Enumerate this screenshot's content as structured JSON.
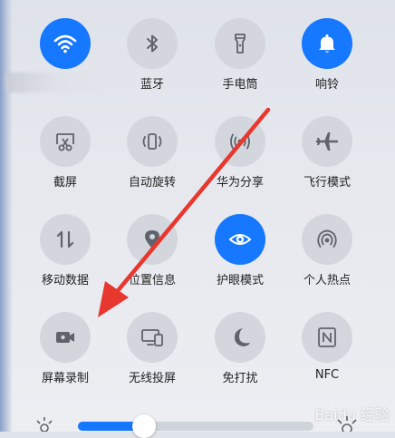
{
  "tiles": [
    {
      "label": "",
      "icon": "wifi-icon",
      "active": true
    },
    {
      "label": "蓝牙",
      "icon": "bluetooth-icon",
      "active": false
    },
    {
      "label": "手电筒",
      "icon": "flashlight-icon",
      "active": false
    },
    {
      "label": "响铃",
      "icon": "bell-icon",
      "active": true
    },
    {
      "label": "截屏",
      "icon": "screenshot-icon",
      "active": false
    },
    {
      "label": "自动旋转",
      "icon": "auto-rotate-icon",
      "active": false
    },
    {
      "label": "华为分享",
      "icon": "share-icon",
      "active": false
    },
    {
      "label": "飞行模式",
      "icon": "airplane-icon",
      "active": false
    },
    {
      "label": "移动数据",
      "icon": "mobile-data-icon",
      "active": false
    },
    {
      "label": "位置信息",
      "icon": "location-icon",
      "active": false
    },
    {
      "label": "护眼模式",
      "icon": "eye-icon",
      "active": true
    },
    {
      "label": "个人热点",
      "icon": "hotspot-icon",
      "active": false
    },
    {
      "label": "屏幕录制",
      "icon": "screen-record-icon",
      "active": false
    },
    {
      "label": "无线投屏",
      "icon": "wireless-projection-icon",
      "active": false
    },
    {
      "label": "免打扰",
      "icon": "moon-icon",
      "active": false
    },
    {
      "label": "NFC",
      "icon": "nfc-icon",
      "active": false
    }
  ],
  "brightness": {
    "level": 0.28
  },
  "watermark": "Baidu 经验",
  "colors": {
    "accent": "#1677ff",
    "tile": "#d3d6dc",
    "arrow": "#e8372f",
    "icon": "#5f636b"
  }
}
